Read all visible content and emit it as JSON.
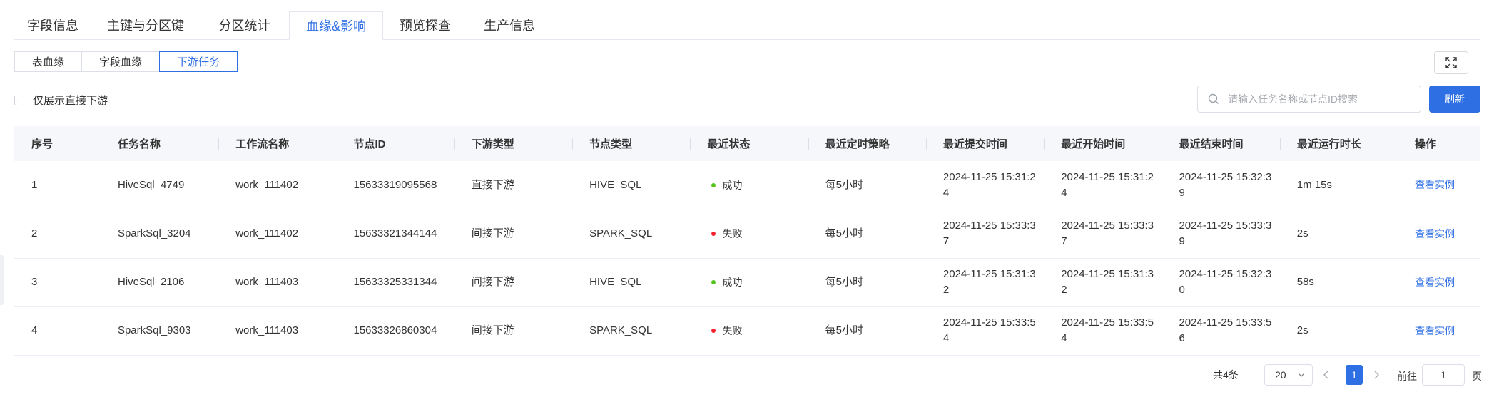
{
  "main_tabs": [
    "字段信息",
    "主键与分区键",
    "分区统计",
    "血缘&影响",
    "预览探查",
    "生产信息"
  ],
  "active_main_tab": "血缘&影响",
  "sub_tabs": [
    "表血缘",
    "字段血缘",
    "下游任务"
  ],
  "active_sub_tab": "下游任务",
  "filter": {
    "only_direct_label": "仅展示直接下游",
    "checked": false
  },
  "search": {
    "placeholder": "请输入任务名称或节点ID搜索",
    "value": ""
  },
  "refresh_label": "刷新",
  "table": {
    "columns": [
      "序号",
      "任务名称",
      "工作流名称",
      "节点ID",
      "下游类型",
      "节点类型",
      "最近状态",
      "最近定时策略",
      "最近提交时间",
      "最近开始时间",
      "最近结束时间",
      "最近运行时长",
      "操作"
    ],
    "rows": [
      {
        "index": "1",
        "task": "HiveSql_4749",
        "workflow": "work_111402",
        "node_id": "15633319095568",
        "downstream_type": "直接下游",
        "node_type": "HIVE_SQL",
        "status": "成功",
        "status_color": "#52c41a",
        "schedule": "每5小时",
        "submit_time": "2024-11-25 15:31:24",
        "start_time": "2024-11-25 15:31:24",
        "end_time": "2024-11-25 15:32:39",
        "duration": "1m 15s",
        "action": "查看实例"
      },
      {
        "index": "2",
        "task": "SparkSql_3204",
        "workflow": "work_111402",
        "node_id": "15633321344144",
        "downstream_type": "间接下游",
        "node_type": "SPARK_SQL",
        "status": "失败",
        "status_color": "#f5222d",
        "schedule": "每5小时",
        "submit_time": "2024-11-25 15:33:37",
        "start_time": "2024-11-25 15:33:37",
        "end_time": "2024-11-25 15:33:39",
        "duration": "2s",
        "action": "查看实例"
      },
      {
        "index": "3",
        "task": "HiveSql_2106",
        "workflow": "work_111403",
        "node_id": "15633325331344",
        "downstream_type": "间接下游",
        "node_type": "HIVE_SQL",
        "status": "成功",
        "status_color": "#52c41a",
        "schedule": "每5小时",
        "submit_time": "2024-11-25 15:31:32",
        "start_time": "2024-11-25 15:31:32",
        "end_time": "2024-11-25 15:32:30",
        "duration": "58s",
        "action": "查看实例"
      },
      {
        "index": "4",
        "task": "SparkSql_9303",
        "workflow": "work_111403",
        "node_id": "15633326860304",
        "downstream_type": "间接下游",
        "node_type": "SPARK_SQL",
        "status": "失败",
        "status_color": "#f5222d",
        "schedule": "每5小时",
        "submit_time": "2024-11-25 15:33:54",
        "start_time": "2024-11-25 15:33:54",
        "end_time": "2024-11-25 15:33:56",
        "duration": "2s",
        "action": "查看实例"
      }
    ]
  },
  "pagination": {
    "total_label": "共4条",
    "page_size": "20",
    "current_page": "1",
    "goto_label": "前往",
    "goto_value": "1",
    "page_suffix": "页"
  },
  "colors": {
    "accent": "#2f6fe4",
    "success": "#52c41a",
    "fail": "#f5222d"
  },
  "icons": {
    "fullscreen": "expand-arrows-icon",
    "search": "search-icon",
    "prev": "chevron-left-icon",
    "next": "chevron-right-icon",
    "select": "chevron-down-icon"
  }
}
